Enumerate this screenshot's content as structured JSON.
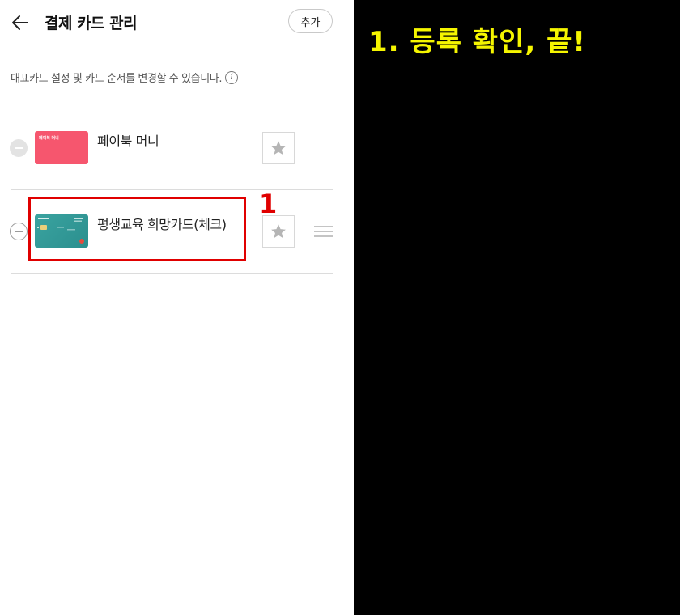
{
  "header": {
    "title": "결제 카드 관리",
    "add_label": "추가"
  },
  "description": "대표카드 설정 및 카드 순서를 변경할 수 있습니다.",
  "info_icon_glyph": "i",
  "cards": [
    {
      "name": "페이북 머니",
      "brand_text": "페이북 머니",
      "color": "#f6566e",
      "icon": "star-icon"
    },
    {
      "name": "평생교육 희망카드(체크)",
      "color": "#2f9896",
      "icon": "star-icon"
    }
  ],
  "annotation": {
    "step_number": "1",
    "caption": "1. 등록 확인, 끝!",
    "highlight_color": "#e00000",
    "caption_color": "#f5f500"
  }
}
